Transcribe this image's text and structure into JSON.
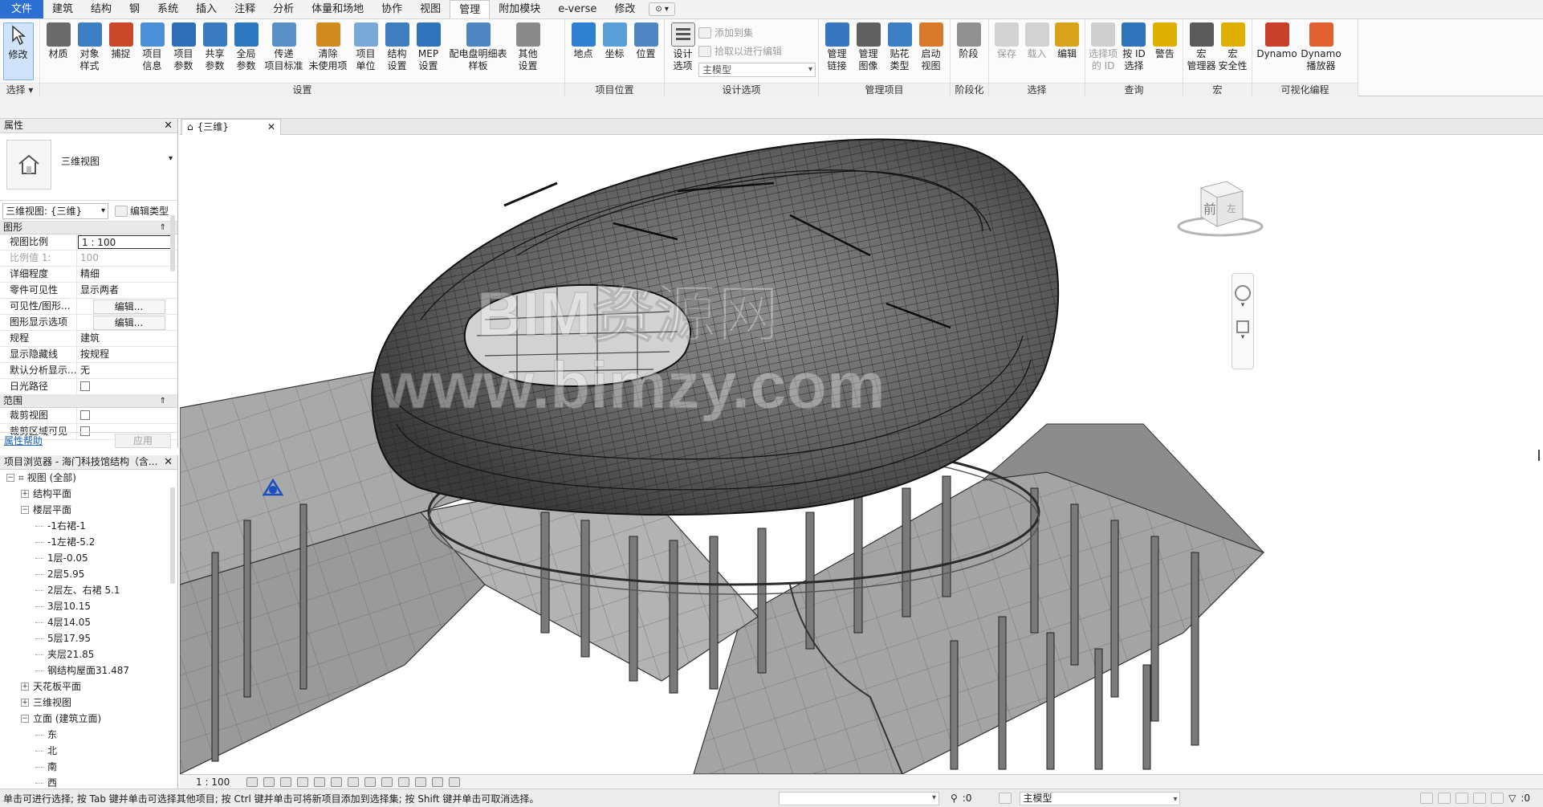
{
  "tabs": [
    {
      "label": "文件",
      "style": "file"
    },
    {
      "label": "建筑"
    },
    {
      "label": "结构"
    },
    {
      "label": "钢"
    },
    {
      "label": "系统"
    },
    {
      "label": "插入"
    },
    {
      "label": "注释"
    },
    {
      "label": "分析"
    },
    {
      "label": "体量和场地"
    },
    {
      "label": "协作"
    },
    {
      "label": "视图"
    },
    {
      "label": "管理",
      "style": "active"
    },
    {
      "label": "附加模块"
    },
    {
      "label": "e-verse"
    },
    {
      "label": "修改"
    }
  ],
  "ribbon": {
    "select": {
      "title": "选择",
      "modify": "修改"
    },
    "settings": {
      "title": "设置",
      "tools": [
        "材质",
        "对象\n样式",
        "捕捉",
        "项目\n信息",
        "项目\n参数",
        "共享\n参数",
        "全局\n参数",
        "传递\n项目标准",
        "清除\n未使用项",
        "项目\n单位",
        "结构\n设置",
        "MEP\n设置",
        "配电盘明细表\n样板",
        "其他\n设置"
      ]
    },
    "location": {
      "title": "项目位置",
      "tools": [
        "地点",
        "坐标",
        "位置"
      ]
    },
    "design": {
      "title": "设计选项",
      "tool": "设计\n选项",
      "add_to_set": "添加到集",
      "pick_to_edit": "拾取以进行编辑",
      "option_value": "主模型"
    },
    "manage_project": {
      "title": "管理项目",
      "tools": [
        "管理\n链接",
        "管理\n图像",
        "贴花\n类型",
        "启动\n视图"
      ]
    },
    "phasing": {
      "title": "阶段化",
      "tools": [
        "阶段"
      ]
    },
    "selection": {
      "title": "选择",
      "tools": [
        "保存",
        "载入",
        "编辑"
      ]
    },
    "inquiry": {
      "title": "查询",
      "tools": [
        "选择项\n的 ID",
        "按 ID\n选择",
        "警告"
      ]
    },
    "macros": {
      "title": "宏",
      "tools": [
        "宏\n管理器",
        "宏\n安全性"
      ]
    },
    "visual": {
      "title": "可视化编程",
      "tools": [
        "Dynamo",
        "Dynamo\n播放器"
      ]
    }
  },
  "properties": {
    "title": "属性",
    "type_name": "三维视图",
    "instance": "三维视图: {三维}",
    "edit_type": "编辑类型",
    "cat_graphics": "图形",
    "rows": [
      {
        "k": "视图比例",
        "v": "1 : 100",
        "kind": "box"
      },
      {
        "k": "比例值 1:",
        "v": "100",
        "kind": "gray"
      },
      {
        "k": "详细程度",
        "v": "精细"
      },
      {
        "k": "零件可见性",
        "v": "显示两者"
      },
      {
        "k": "可见性/图形...",
        "v": "编辑...",
        "kind": "btn"
      },
      {
        "k": "图形显示选项",
        "v": "编辑...",
        "kind": "btn"
      },
      {
        "k": "规程",
        "v": "建筑"
      },
      {
        "k": "显示隐藏线",
        "v": "按规程"
      },
      {
        "k": "默认分析显示...",
        "v": "无"
      },
      {
        "k": "日光路径",
        "v": "",
        "kind": "chk"
      }
    ],
    "cat_extents": "范围",
    "rows2": [
      {
        "k": "裁剪视图",
        "v": "",
        "kind": "chk"
      },
      {
        "k": "裁剪区域可见",
        "v": "",
        "kind": "chk"
      }
    ],
    "help": "属性帮助",
    "apply": "应用"
  },
  "browser": {
    "title": "项目浏览器 - 海门科技馆结构（含...",
    "nodes": [
      {
        "label": "视图 (全部)",
        "level": 0,
        "toggle": "−",
        "root": true
      },
      {
        "label": "结构平面",
        "level": 1,
        "toggle": "+"
      },
      {
        "label": "楼层平面",
        "level": 1,
        "toggle": "−"
      },
      {
        "label": "-1右裙-1",
        "level": 2
      },
      {
        "label": "-1左裙-5.2",
        "level": 2
      },
      {
        "label": "1层-0.05",
        "level": 2
      },
      {
        "label": "2层5.95",
        "level": 2
      },
      {
        "label": "2层左、右裙 5.1",
        "level": 2
      },
      {
        "label": "3层10.15",
        "level": 2
      },
      {
        "label": "4层14.05",
        "level": 2
      },
      {
        "label": "5层17.95",
        "level": 2
      },
      {
        "label": "夹层21.85",
        "level": 2
      },
      {
        "label": "钢结构屋面31.487",
        "level": 2
      },
      {
        "label": "天花板平面",
        "level": 1,
        "toggle": "+"
      },
      {
        "label": "三维视图",
        "level": 1,
        "toggle": "+"
      },
      {
        "label": "立面 (建筑立面)",
        "level": 1,
        "toggle": "−"
      },
      {
        "label": "东",
        "level": 2
      },
      {
        "label": "北",
        "level": 2
      },
      {
        "label": "南",
        "level": 2
      },
      {
        "label": "西",
        "level": 2
      }
    ]
  },
  "view": {
    "tab": "{三维}",
    "scale": "1 : 100",
    "cube_face": "前",
    "cube_side": "左",
    "watermark1": "BIM资源网",
    "watermark2": "www.bimzy.com"
  },
  "status": {
    "message": "单击可进行选择; 按 Tab 键并单击可选择其他项目; 按 Ctrl 键并单击可将新项目添加到选择集; 按 Shift 键并单击可取消选择。",
    "count1": ":0",
    "model": "主模型",
    "filter_count": ":0"
  }
}
